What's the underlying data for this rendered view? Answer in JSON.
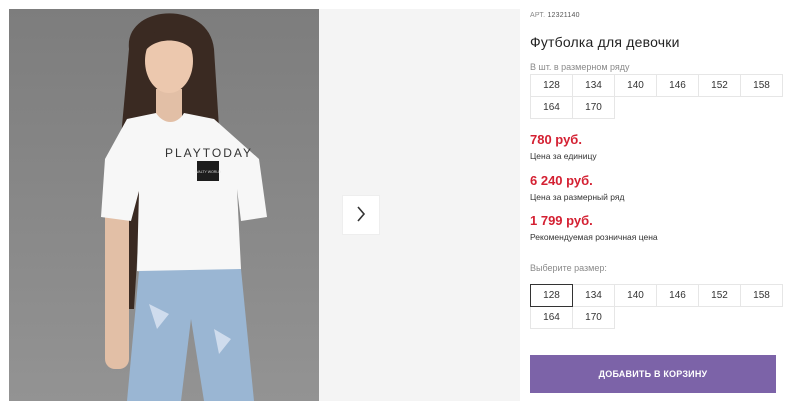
{
  "gallery": {
    "next_icon": "chevron-right-icon",
    "shirt_brand": "PLAYTODAY",
    "shirt_badge": "WALTY WORLD"
  },
  "product": {
    "article_label": "АРТ.",
    "article_value": "12321140",
    "title": "Футболка для девочки",
    "pack_label": "В шт. в размерном ряду",
    "pack_sizes": [
      "128",
      "134",
      "140",
      "146",
      "152",
      "158",
      "164",
      "170"
    ],
    "price_unit": "780 руб.",
    "price_unit_note": "Цена за единицу",
    "price_pack": "6 240 руб.",
    "price_pack_note": "Цена за размерный ряд",
    "price_rrp": "1 799 руб.",
    "price_rrp_note": "Рекомендуемая розничная цена",
    "choose_label": "Выберите размер:",
    "sizes": [
      "128",
      "134",
      "140",
      "146",
      "152",
      "158",
      "164",
      "170"
    ],
    "selected_size": "128",
    "add_to_cart": "ДОБАВИТЬ В КОРЗИНУ"
  },
  "colors": {
    "price": "#d42032",
    "button": "#7c63a8"
  }
}
